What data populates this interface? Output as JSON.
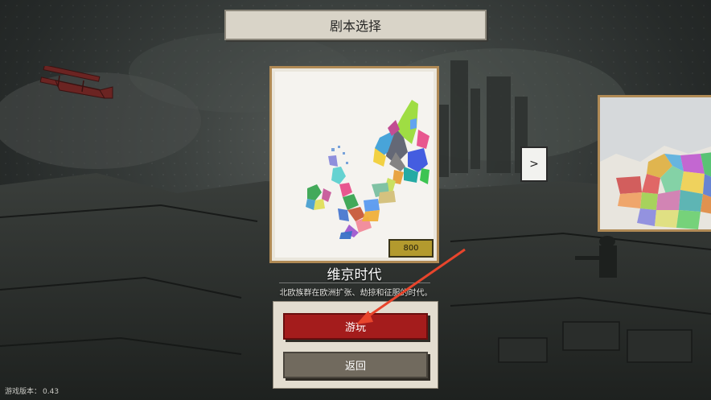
{
  "header": {
    "title": "剧本选择"
  },
  "scenario": {
    "name": "维京时代",
    "description": "北欧族群在欧洲扩张、劫掠和征服的时代。",
    "score": "800"
  },
  "buttons": {
    "play_label": "游玩",
    "back_label": "返回",
    "next_label": ">"
  },
  "footer": {
    "version_label": "游戏版本：",
    "version_value": "0.43"
  },
  "colors": {
    "play_button": "#a41c1c",
    "back_button": "#716a5e",
    "card_border": "#b08a55",
    "score_badge": "#b39a2e",
    "annotation_arrow": "#e8452c"
  },
  "icons": {
    "biplane": "biplane-icon",
    "next": "chevron-right"
  }
}
